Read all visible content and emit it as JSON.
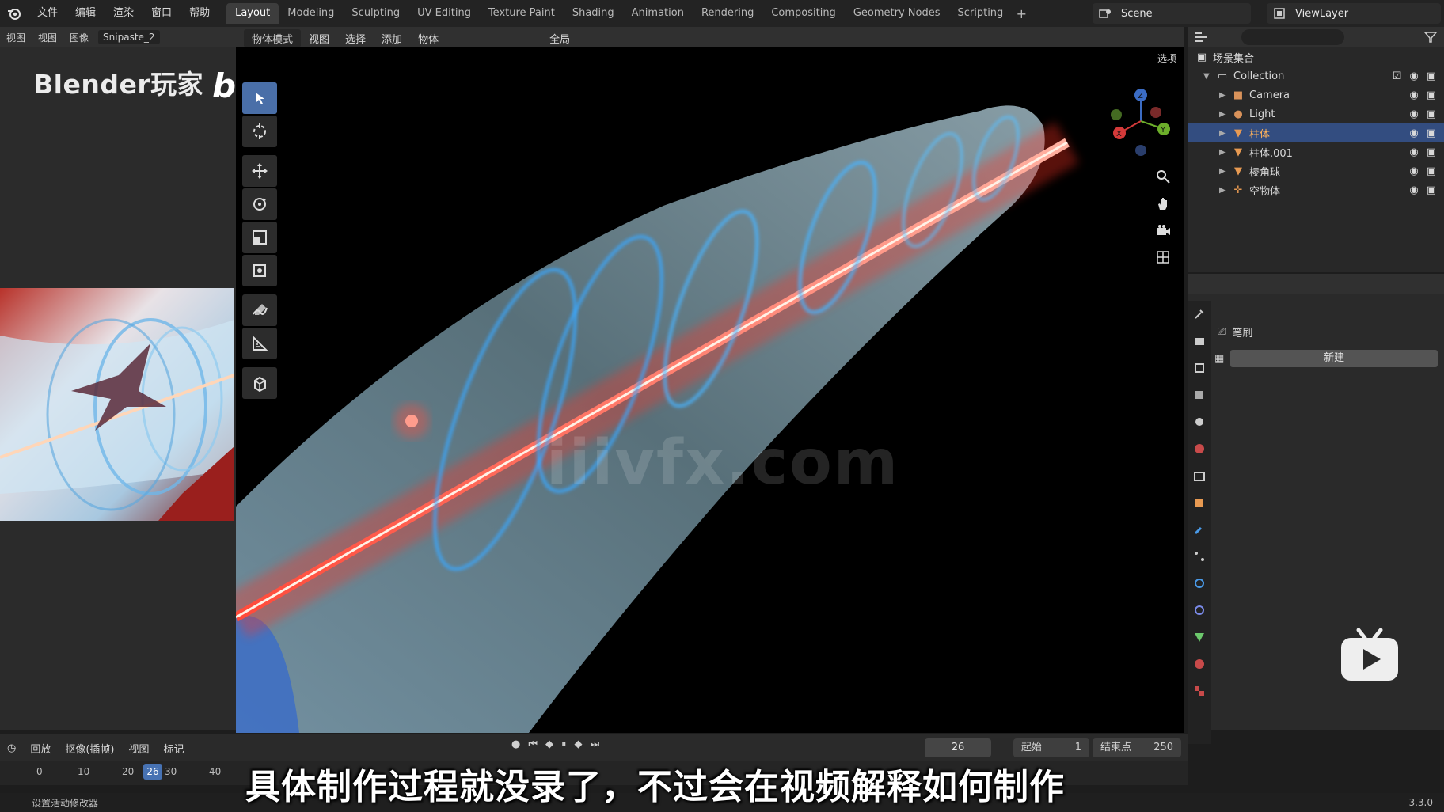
{
  "menus": [
    "文件",
    "编辑",
    "渲染",
    "窗口",
    "帮助"
  ],
  "workspaces": [
    "Layout",
    "Modeling",
    "Sculpting",
    "UV Editing",
    "Texture Paint",
    "Shading",
    "Animation",
    "Rendering",
    "Compositing",
    "Geometry Nodes",
    "Scripting"
  ],
  "active_workspace": "Layout",
  "scene": "Scene",
  "view_layer": "ViewLayer",
  "image_editor": {
    "header": [
      "视图",
      "视图",
      "图像"
    ],
    "image_name": "Snipaste_2",
    "brand": "Blender玩家",
    "bili": "bilibili"
  },
  "viewport": {
    "mode": "物体模式",
    "menus": [
      "视图",
      "选择",
      "添加",
      "物体"
    ],
    "transform_orientation": "全局",
    "options": "选项"
  },
  "site_watermark": "iiivfx.com",
  "outliner": {
    "root": "场景集合",
    "collection": "Collection",
    "objects": [
      {
        "name": "Camera",
        "icon": "camera-icon",
        "selected": false
      },
      {
        "name": "Light",
        "icon": "light-icon",
        "selected": false
      },
      {
        "name": "柱体",
        "icon": "mesh-icon",
        "selected": true
      },
      {
        "name": "柱体.001",
        "icon": "mesh-icon",
        "selected": false
      },
      {
        "name": "棱角球",
        "icon": "mesh-icon",
        "selected": false
      },
      {
        "name": "空物体",
        "icon": "empty-icon",
        "selected": false
      }
    ]
  },
  "properties": {
    "brush_label": "笔刷",
    "new_label": "新建"
  },
  "timeline": {
    "menus": [
      "回放",
      "抠像(插帧)",
      "视图",
      "标记"
    ],
    "current_frame": "26",
    "start_label": "起始",
    "start": "1",
    "end_label": "结束点",
    "end": "250",
    "ticks": [
      "0",
      "10",
      "20",
      "30",
      "40"
    ]
  },
  "status": {
    "left": "设置活动修改器",
    "version": "3.3.0"
  },
  "subtitle": "具体制作过程就没录了，不过会在视频解释如何制作"
}
